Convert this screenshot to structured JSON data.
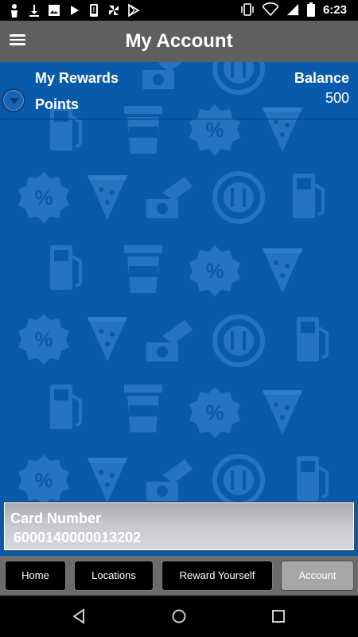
{
  "status_bar": {
    "time": "6:23",
    "icons": [
      "person-icon",
      "download-icon",
      "image-icon",
      "play-icon",
      "phone-notification-icon",
      "pinwheel-icon",
      "play-store-icon",
      "vibrate-icon",
      "wifi-icon",
      "signal-icon",
      "battery-icon"
    ]
  },
  "app_bar": {
    "title": "My Account",
    "menu_icon": "hamburger-menu-icon"
  },
  "rewards": {
    "title": "My Rewards",
    "balance_header": "Balance",
    "items": [
      {
        "label": "Points",
        "balance": "500"
      }
    ]
  },
  "card": {
    "label": "Card Number",
    "number": "6000140000013202"
  },
  "tabs": [
    {
      "label": "Home",
      "active": false
    },
    {
      "label": "Locations",
      "active": false
    },
    {
      "label": "Reward Yourself",
      "active": false
    },
    {
      "label": "Account",
      "active": true
    }
  ],
  "colors": {
    "content_bg": "#0a5aac",
    "app_bar_bg": "#5f5f5f",
    "tab_bar_bg": "#6b6b6b",
    "active_tab_bg": "#a7a7a7"
  },
  "nav_bar": {
    "icons": [
      "back-icon",
      "home-icon",
      "recents-icon"
    ]
  }
}
